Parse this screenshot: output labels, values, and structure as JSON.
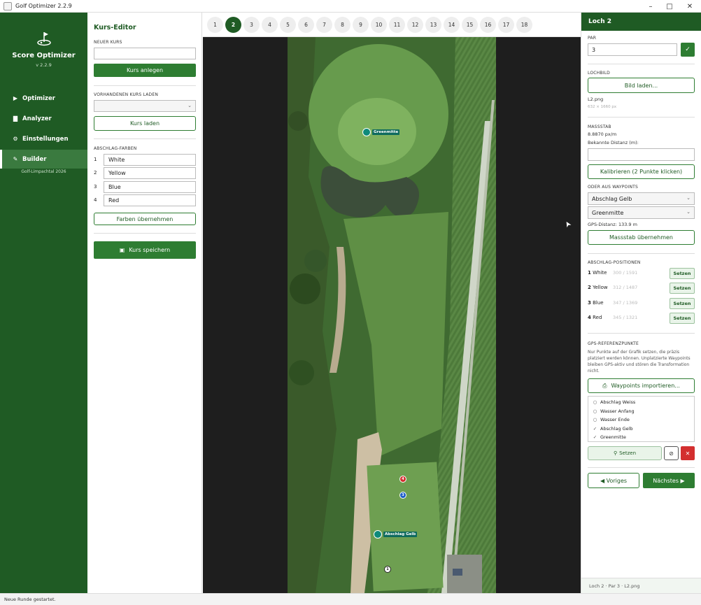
{
  "window": {
    "title": "Golf Optimizer  2.2.9",
    "minimize": "–",
    "maximize": "□",
    "close": "✕"
  },
  "nav": {
    "brand": "Score Optimizer",
    "version": "v 2.2.9",
    "items": [
      {
        "label": "Optimizer",
        "icon": "play-icon"
      },
      {
        "label": "Analyzer",
        "icon": "chart-icon"
      },
      {
        "label": "Einstellungen",
        "icon": "gear-icon"
      },
      {
        "label": "Builder",
        "icon": "wrench-icon"
      }
    ],
    "active_subtitle": "Golf-Limpachtal 2026"
  },
  "editor": {
    "title": "Kurs-Editor",
    "new_course_label": "NEUER KURS",
    "new_course_value": "",
    "create_button": "Kurs anlegen",
    "load_label": "VORHANDENEN KURS LADEN",
    "load_select_value": "",
    "load_button": "Kurs laden",
    "tee_colors_label": "ABSCHLAG-FARBEN",
    "tee_colors": [
      {
        "num": "1",
        "name": "White"
      },
      {
        "num": "2",
        "name": "Yellow"
      },
      {
        "num": "3",
        "name": "Blue"
      },
      {
        "num": "4",
        "name": "Red"
      }
    ],
    "apply_colors_button": "Farben übernehmen",
    "save_button": "Kurs speichern"
  },
  "holes": {
    "numbers": [
      "1",
      "2",
      "3",
      "4",
      "5",
      "6",
      "7",
      "8",
      "9",
      "10",
      "11",
      "12",
      "13",
      "14",
      "15",
      "16",
      "17",
      "18"
    ],
    "active": "2"
  },
  "map": {
    "markers": [
      {
        "label": "Greenmitte"
      },
      {
        "label": "Abschlag Gelb"
      }
    ],
    "tee_dots": [
      {
        "num": "4",
        "color": "#d32f2f"
      },
      {
        "num": "3",
        "color": "#1e5fc8"
      },
      {
        "num": "1",
        "color": "#ffffff"
      }
    ]
  },
  "right": {
    "header": "Loch  2",
    "par_label": "PAR",
    "par_value": "3",
    "par_confirm": "✓",
    "image_label": "LOCHBILD",
    "image_button": "Bild laden...",
    "image_file": "L2.png",
    "image_dims": "632 × 1660 px",
    "scale_label": "MASSSTAB",
    "scale_value": "8.8870  px/m",
    "known_distance_label": "Bekannte Distanz (m):",
    "known_distance_value": "",
    "calibrate_button": "Kalibrieren (2 Punkte klicken)",
    "waypoints_label": "ODER AUS WAYPOINTS",
    "waypoint_from": "Abschlag Gelb",
    "waypoint_to": "Greenmitte",
    "gps_distance": "GPS-Distanz: 133.9 m",
    "apply_scale_button": "Massstab übernehmen",
    "tee_positions_label": "ABSCHLAG-POSITIONEN",
    "tee_positions": [
      {
        "num": "1",
        "name": "White",
        "coord": "300 / 1591"
      },
      {
        "num": "2",
        "name": "Yellow",
        "coord": "312 / 1487"
      },
      {
        "num": "3",
        "name": "Blue",
        "coord": "347 / 1369"
      },
      {
        "num": "4",
        "name": "Red",
        "coord": "345 / 1321"
      }
    ],
    "set_button": "Setzen",
    "gps_ref_label": "GPS-REFERENZPUNKTE",
    "gps_ref_text_1": "Nur Punkte auf der Grafik setzen, die präzis",
    "gps_ref_text_2": "platziert werden können. Unplatzierte Waypoints",
    "gps_ref_text_3": "bleiben GPS-aktiv und stören die Transformation",
    "gps_ref_text_4": "nicht.",
    "import_button": "Waypoints importieren...",
    "waypoints": [
      {
        "mark": "○",
        "name": "Abschlag Weiss"
      },
      {
        "mark": "○",
        "name": "Wasser Anfang"
      },
      {
        "mark": "○",
        "name": "Wasser Ende"
      },
      {
        "mark": "✓",
        "name": "Abschlag Gelb"
      },
      {
        "mark": "✓",
        "name": "Greenmitte"
      }
    ],
    "wp_set_button": "Setzen",
    "wp_clear_button": "⊘",
    "wp_delete_button": "✕",
    "prev_button": "◀ Voriges",
    "next_button": "Nächstes ▶",
    "footer": "Loch 2  ·  Par 3  ·  L2.png"
  },
  "status": "Neue Runde gestartet."
}
